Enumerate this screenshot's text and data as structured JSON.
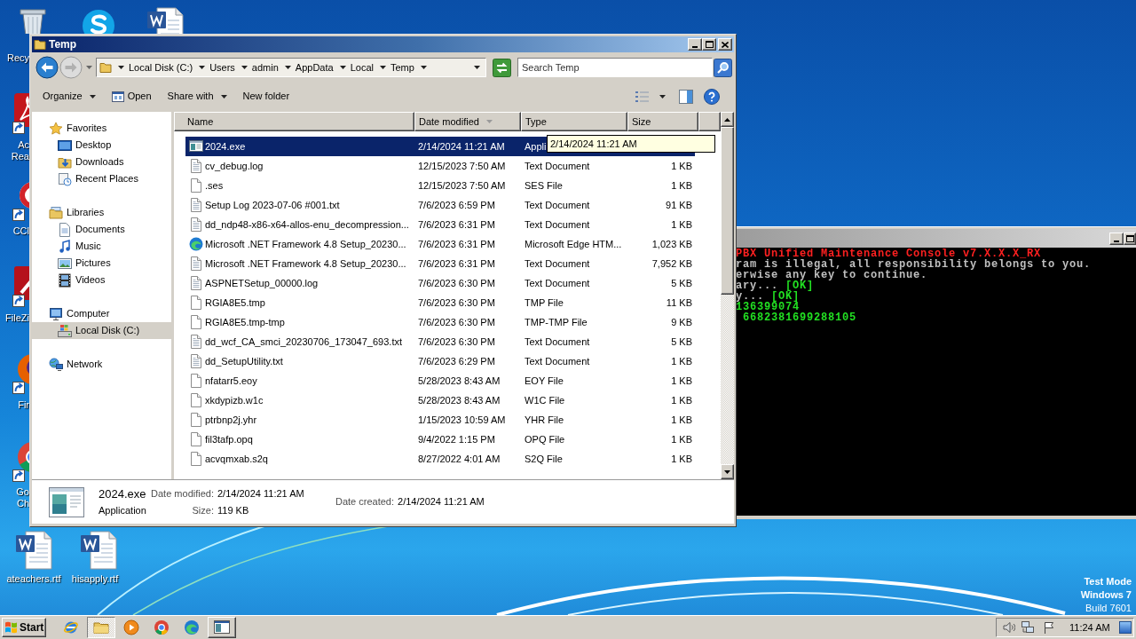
{
  "desktop_icons": [
    {
      "kind": "recycle_bin",
      "label": "Recy"
    },
    {
      "kind": "chat_app"
    },
    {
      "kind": "word_doc"
    },
    {
      "kind": "pdf_reader",
      "label": "Ac Rea"
    },
    {
      "kind": "cleaner",
      "label": "CCl"
    },
    {
      "kind": "ftp_client",
      "label": "FileZi"
    },
    {
      "kind": "fox_browser",
      "label": "Fir"
    },
    {
      "kind": "chrome_browser",
      "label": "Go Ch"
    },
    {
      "kind": "word_doc",
      "label": "ateachers.rtf"
    },
    {
      "kind": "word_doc",
      "label": "hisapply.rtf"
    }
  ],
  "desktop_notice": [
    "Test Mode",
    "Windows 7",
    "Build 7601"
  ],
  "console": {
    "lines": [
      {
        "segments": [
          {
            "text": "PBX Unified Maintenance Console v7.X.X.X_RX",
            "kind": "heading"
          }
        ]
      },
      {
        "segments": [
          {
            "text": "ram is illegal, all responsibility belongs to you.",
            "kind": "plain"
          }
        ]
      },
      {
        "segments": [
          {
            "text": "erwise any key to continue.",
            "kind": "plain"
          }
        ]
      },
      {
        "segments": [
          {
            "text": "ary... ",
            "kind": "plain"
          },
          {
            "text": "[OK]",
            "kind": "ok"
          }
        ]
      },
      {
        "segments": [
          {
            "text": "y... ",
            "kind": "plain"
          },
          {
            "text": "[OK]",
            "kind": "ok"
          }
        ]
      },
      {
        "segments": [
          {
            "text": "136399074",
            "kind": "ok"
          }
        ]
      },
      {
        "segments": [
          {
            "text": " 6682381699288105",
            "kind": "ok"
          }
        ]
      }
    ]
  },
  "explorer": {
    "title": "Temp",
    "nav_buttons": [
      {
        "kind": "back",
        "disabled": false
      },
      {
        "kind": "forward",
        "disabled": true
      }
    ],
    "address": [
      "Local Disk (C:)",
      "Users",
      "admin",
      "AppData",
      "Local",
      "Temp"
    ],
    "search": {
      "placeholder": "Search Temp"
    },
    "toolbar": [
      {
        "label": "Organize",
        "kind": "menu"
      },
      {
        "label": "Open",
        "kind": "open"
      },
      {
        "label": "Share with",
        "kind": "menu"
      },
      {
        "label": "New folder",
        "kind": "plain"
      }
    ],
    "navigation": [
      {
        "label": "Favorites",
        "kind": "favorites",
        "selected": false,
        "children": [
          {
            "label": "Desktop",
            "kind": "desktop",
            "selected": false
          },
          {
            "label": "Downloads",
            "kind": "downloads",
            "selected": false
          },
          {
            "label": "Recent Places",
            "kind": "recent",
            "selected": false
          }
        ]
      },
      {
        "label": "Libraries",
        "kind": "libraries",
        "selected": false,
        "children": [
          {
            "label": "Documents",
            "kind": "documents",
            "selected": false
          },
          {
            "label": "Music",
            "kind": "music",
            "selected": false
          },
          {
            "label": "Pictures",
            "kind": "pictures",
            "selected": false
          },
          {
            "label": "Videos",
            "kind": "videos",
            "selected": false
          }
        ]
      },
      {
        "label": "Computer",
        "kind": "computer",
        "selected": false,
        "children": [
          {
            "label": "Local Disk (C:)",
            "kind": "drive",
            "selected": true
          }
        ]
      },
      {
        "label": "Network",
        "kind": "network",
        "selected": false
      }
    ],
    "columns": [
      {
        "label": "Name",
        "sorted": false
      },
      {
        "label": "Date modified",
        "sorted": true
      },
      {
        "label": "Type",
        "sorted": false
      },
      {
        "label": "Size",
        "sorted": false
      }
    ],
    "files": [
      {
        "name": "2024.exe",
        "date": "2/14/2024 11:21 AM",
        "type": "Appli",
        "kind": "app",
        "selected": true
      },
      {
        "name": "cv_debug.log",
        "date": "12/15/2023 7:50 AM",
        "type": "Text Document",
        "size": "1 KB",
        "kind": "text",
        "selected": false
      },
      {
        "name": ".ses",
        "date": "12/15/2023 7:50 AM",
        "type": "SES File",
        "size": "1 KB",
        "kind": "blank",
        "selected": false
      },
      {
        "name": "Setup Log 2023-07-06 #001.txt",
        "date": "7/6/2023 6:59 PM",
        "type": "Text Document",
        "size": "91 KB",
        "kind": "text",
        "selected": false
      },
      {
        "name": "dd_ndp48-x86-x64-allos-enu_decompression...",
        "date": "7/6/2023 6:31 PM",
        "type": "Text Document",
        "size": "1 KB",
        "kind": "text",
        "selected": false
      },
      {
        "name": "Microsoft .NET Framework 4.8 Setup_20230...",
        "date": "7/6/2023 6:31 PM",
        "type": "Microsoft Edge HTM...",
        "size": "1,023 KB",
        "kind": "edge",
        "selected": false
      },
      {
        "name": "Microsoft .NET Framework 4.8 Setup_20230...",
        "date": "7/6/2023 6:31 PM",
        "type": "Text Document",
        "size": "7,952 KB",
        "kind": "text",
        "selected": false
      },
      {
        "name": "ASPNETSetup_00000.log",
        "date": "7/6/2023 6:30 PM",
        "type": "Text Document",
        "size": "5 KB",
        "kind": "text",
        "selected": false
      },
      {
        "name": "RGIA8E5.tmp",
        "date": "7/6/2023 6:30 PM",
        "type": "TMP File",
        "size": "11 KB",
        "kind": "blank",
        "selected": false
      },
      {
        "name": "RGIA8E5.tmp-tmp",
        "date": "7/6/2023 6:30 PM",
        "type": "TMP-TMP File",
        "size": "9 KB",
        "kind": "blank",
        "selected": false
      },
      {
        "name": "dd_wcf_CA_smci_20230706_173047_693.txt",
        "date": "7/6/2023 6:30 PM",
        "type": "Text Document",
        "size": "5 KB",
        "kind": "text",
        "selected": false
      },
      {
        "name": "dd_SetupUtility.txt",
        "date": "7/6/2023 6:29 PM",
        "type": "Text Document",
        "size": "1 KB",
        "kind": "text",
        "selected": false
      },
      {
        "name": "nfatarr5.eoy",
        "date": "5/28/2023 8:43 AM",
        "type": "EOY File",
        "size": "1 KB",
        "kind": "blank",
        "selected": false
      },
      {
        "name": "xkdypizb.w1c",
        "date": "5/28/2023 8:43 AM",
        "type": "W1C File",
        "size": "1 KB",
        "kind": "blank",
        "selected": false
      },
      {
        "name": "ptrbnp2j.yhr",
        "date": "1/15/2023 10:59 AM",
        "type": "YHR File",
        "size": "1 KB",
        "kind": "blank",
        "selected": false
      },
      {
        "name": "fil3tafp.opq",
        "date": "9/4/2022 1:15 PM",
        "type": "OPQ File",
        "size": "1 KB",
        "kind": "blank",
        "selected": false
      },
      {
        "name": "acvqmxab.s2q",
        "date": "8/27/2022 4:01 AM",
        "type": "S2Q File",
        "size": "1 KB",
        "kind": "blank",
        "selected": false
      }
    ],
    "tooltip": {
      "text": "2/14/2024 11:21 AM"
    },
    "details": {
      "name": "2024.exe",
      "type": "Application",
      "columns": [
        [
          {
            "label": "Date modified:",
            "value": "2/14/2024 11:21 AM"
          },
          {
            "label": "Size:",
            "value": "119 KB"
          }
        ],
        [
          {
            "label": "Date created:",
            "value": "2/14/2024 11:21 AM"
          }
        ]
      ]
    }
  },
  "taskbar": {
    "start": "Start",
    "buttons": [
      {
        "kind": "ie",
        "running": false,
        "selected": false
      },
      {
        "kind": "explorer",
        "running": true,
        "selected": true
      },
      {
        "kind": "media",
        "running": false,
        "selected": false
      },
      {
        "kind": "chrome",
        "running": false,
        "selected": false
      },
      {
        "kind": "edge",
        "running": false,
        "selected": false
      },
      {
        "kind": "console",
        "running": true,
        "selected": false
      }
    ],
    "clock": "11:24 AM"
  }
}
